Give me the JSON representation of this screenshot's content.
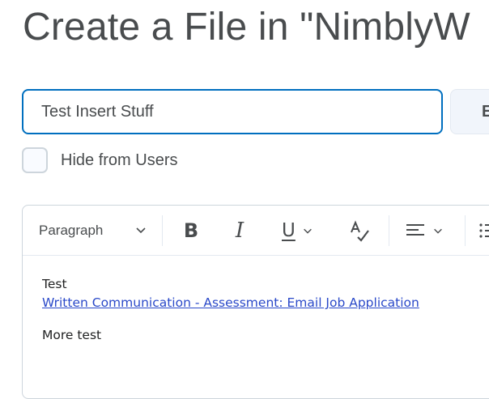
{
  "page": {
    "title": "Create a File in \"NimblyW"
  },
  "form": {
    "title_value": "Test Insert Stuff",
    "side_button_label": "E",
    "hide_label": "Hide from Users"
  },
  "toolbar": {
    "format_label": "Paragraph",
    "bold_label": "B",
    "italic_label": "I",
    "underline_label": "U"
  },
  "content": {
    "line1": "Test",
    "link_text": "Written Communication - Assessment: Email Job Application",
    "line3": "More test"
  },
  "icons": {
    "format_dropdown": "chevron-down-icon",
    "underline_dropdown": "chevron-down-icon",
    "spellcheck": "spellcheck-icon",
    "align": "align-left-icon",
    "align_dropdown": "chevron-down-icon",
    "list": "list-icon"
  },
  "colors": {
    "accent": "#006fbf",
    "link": "#2a49c9",
    "title_text": "#494c4e"
  }
}
